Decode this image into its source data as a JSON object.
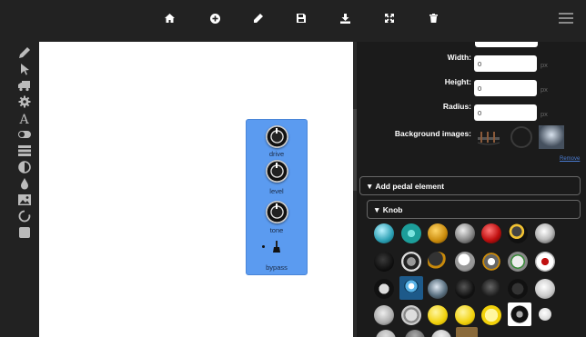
{
  "toolbar": {
    "icons": [
      "home-icon",
      "add-circle-icon",
      "pencil-icon",
      "save-icon",
      "download-icon",
      "fullscreen-icon",
      "trash-icon",
      "menu-icon"
    ]
  },
  "left_tools": [
    "pencil-icon",
    "cursor-icon",
    "truck-icon",
    "gear-icon",
    "text-icon",
    "toggle-icon",
    "stack-icon",
    "contrast-icon",
    "droplet-icon",
    "image-icon",
    "circle-icon",
    "square-icon"
  ],
  "pedal": {
    "knobs": [
      {
        "label": "drive"
      },
      {
        "label": "level"
      },
      {
        "label": "tone"
      }
    ],
    "switch_label": "bypass",
    "color": "#5b9bf0"
  },
  "properties": {
    "width": {
      "label": "Width:",
      "value": "0",
      "unit": "px"
    },
    "height": {
      "label": "Height:",
      "value": "0",
      "unit": "px"
    },
    "radius": {
      "label": "Radius:",
      "value": "0",
      "unit": "px"
    },
    "background_images_label": "Background images:",
    "remove_link": "Remove"
  },
  "sections": {
    "add_element": "▼  Add pedal element",
    "knob": "▼  Knob"
  },
  "knob_palette": {
    "count": 29
  }
}
